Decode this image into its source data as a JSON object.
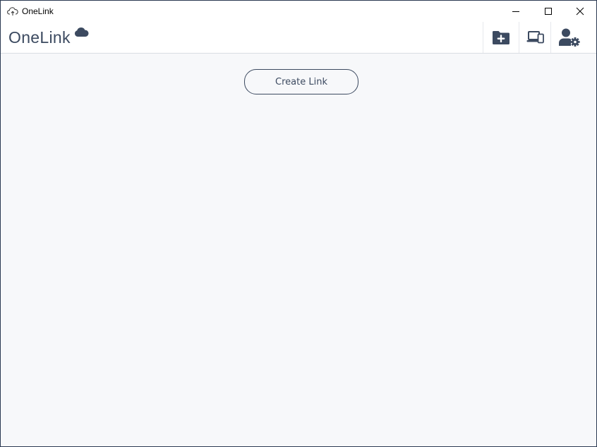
{
  "window": {
    "title": "OneLink",
    "controls": {
      "minimize": "minimize-icon",
      "maximize": "maximize-icon",
      "close": "close-icon"
    }
  },
  "header": {
    "brand": "OneLink",
    "brand_icon": "cloud-icon",
    "actions": [
      {
        "name": "new-folder",
        "icon": "folder-plus-icon"
      },
      {
        "name": "devices",
        "icon": "devices-icon"
      },
      {
        "name": "account-settings",
        "icon": "user-gear-icon"
      }
    ]
  },
  "main": {
    "create_link_label": "Create Link"
  },
  "colors": {
    "accent": "#3c4a60",
    "background": "#f7f8fa",
    "header": "#ffffff"
  }
}
